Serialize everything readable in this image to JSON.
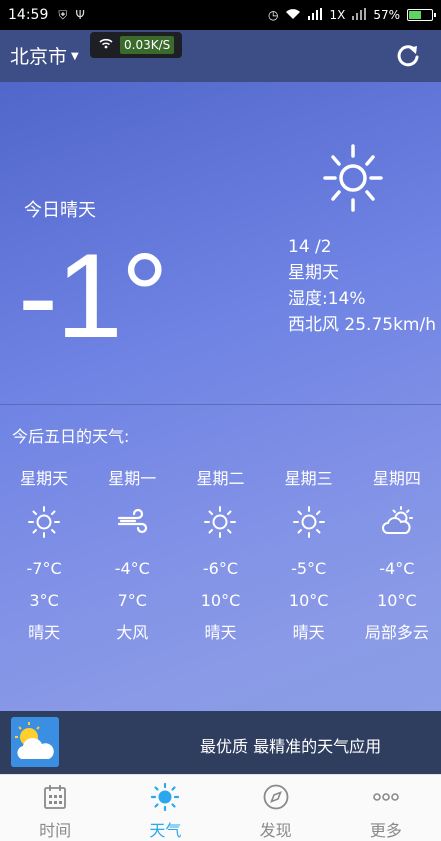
{
  "status_bar": {
    "time": "14:59",
    "network": "1X",
    "battery": "57%",
    "battery_level": 0.57
  },
  "header": {
    "city": "北京市",
    "net_speed": "0.03K/S"
  },
  "today": {
    "label": "今日晴天",
    "temperature": "-1°",
    "date": "14 /2",
    "weekday": "星期天",
    "humidity": "湿度:14%",
    "wind": "西北风 25.75km/h",
    "icon": "sun-icon"
  },
  "forecast": {
    "title": "今后五日的天气:",
    "days": [
      {
        "name": "星期天",
        "icon": "sun-icon",
        "low": "-7°C",
        "high": "3°C",
        "cond": "晴天"
      },
      {
        "name": "星期一",
        "icon": "wind-icon",
        "low": "-4°C",
        "high": "7°C",
        "cond": "大风"
      },
      {
        "name": "星期二",
        "icon": "sun-icon",
        "low": "-6°C",
        "high": "10°C",
        "cond": "晴天"
      },
      {
        "name": "星期三",
        "icon": "sun-icon",
        "low": "-5°C",
        "high": "10°C",
        "cond": "晴天"
      },
      {
        "name": "星期四",
        "icon": "partly-cloudy-icon",
        "low": "-4°C",
        "high": "10°C",
        "cond": "局部多云"
      }
    ]
  },
  "banner": {
    "text": "最优质 最精准的天气应用"
  },
  "tabs": [
    {
      "label": "时间",
      "icon": "calendar-icon",
      "active": false
    },
    {
      "label": "天气",
      "icon": "sun-icon",
      "active": true
    },
    {
      "label": "发现",
      "icon": "compass-icon",
      "active": false
    },
    {
      "label": "更多",
      "icon": "more-icon",
      "active": false
    }
  ],
  "colors": {
    "accent": "#29a8ee",
    "header": "#3d4d86"
  }
}
